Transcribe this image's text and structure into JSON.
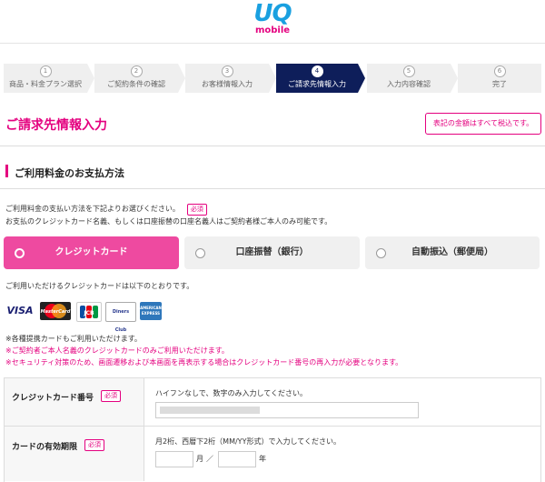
{
  "logo": {
    "brand": "UQ",
    "sub": "mobile"
  },
  "steps": [
    {
      "num": "1",
      "label": "商品・料金プラン選択",
      "active": false
    },
    {
      "num": "2",
      "label": "ご契約条件の確認",
      "active": false
    },
    {
      "num": "3",
      "label": "お客様情報入力",
      "active": false
    },
    {
      "num": "4",
      "label": "ご請求先情報入力",
      "active": true
    },
    {
      "num": "5",
      "label": "入力内容確認",
      "active": false
    },
    {
      "num": "6",
      "label": "完了",
      "active": false
    }
  ],
  "page": {
    "title": "ご請求先情報入力",
    "tax_button": "表記の金額はすべて税込です。"
  },
  "payment": {
    "section_title": "ご利用料金のお支払方法",
    "desc1": "ご利用料金の支払い方法を下記よりお選びください。",
    "required": "必須",
    "desc2": "お支払のクレジットカード名義、もしくは口座振替の口座名義人はご契約者様ご本人のみ可能です。",
    "options": [
      {
        "label": "クレジットカード",
        "selected": true
      },
      {
        "label": "口座振替（銀行）",
        "selected": false
      },
      {
        "label": "自動振込（郵便局）",
        "selected": false
      }
    ],
    "card_note": "ご利用いただけるクレジットカードは以下のとおりです。",
    "card_brands": [
      "VISA",
      "MasterCard",
      "JCB",
      "Diners Club",
      "AMERICAN EXPRESS"
    ],
    "notes": [
      "※各種提携カードもご利用いただけます。",
      "※ご契約者ご本人名義のクレジットカードのみご利用いただけます。",
      "※セキュリティ対策のため、画面遷移および本画面を再表示する場合はクレジットカード番号の再入力が必要となります。"
    ]
  },
  "form": {
    "card_number": {
      "label": "クレジットカード番号",
      "required": "必須",
      "hint": "ハイフンなしで、数字のみ入力してください。"
    },
    "expiry": {
      "label": "カードの有効期限",
      "required": "必須",
      "hint": "月2桁、西暦下2桁（MM/YY形式）で入力してください。",
      "month_unit": "月",
      "slash": "／",
      "year_unit": "年"
    }
  },
  "colors": {
    "accent": "#e4007f",
    "active_step": "#0e1e5a",
    "selected_option": "#ee4aa0"
  }
}
